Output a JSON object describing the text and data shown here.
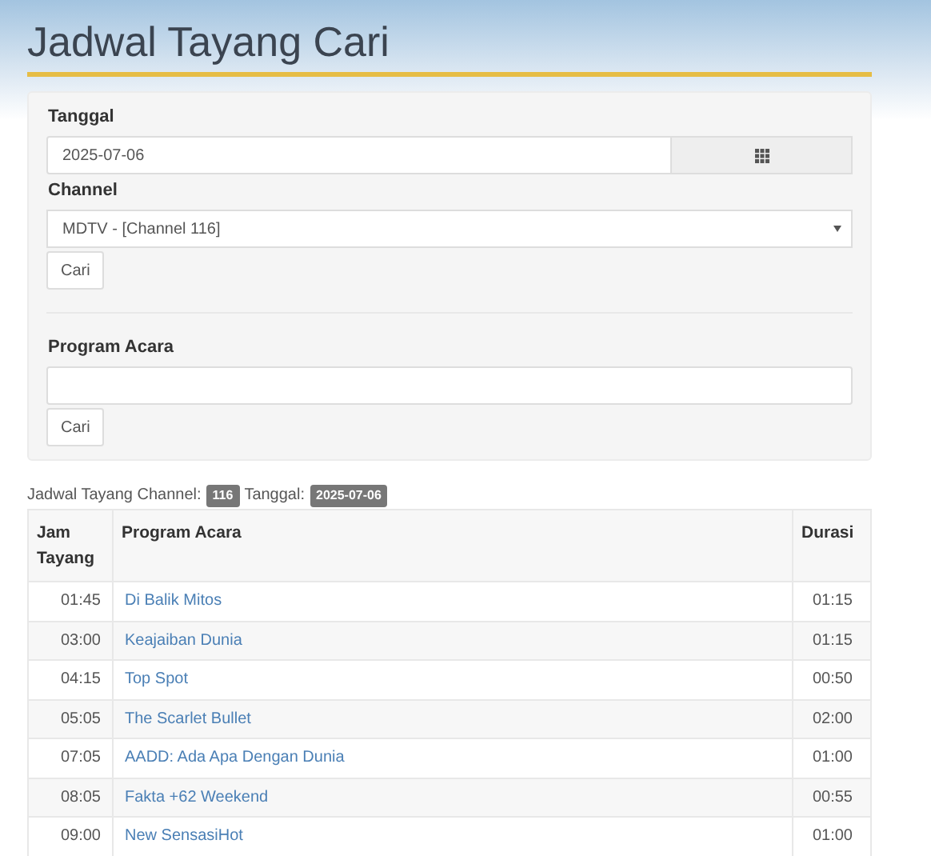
{
  "title": "Jadwal Tayang Cari",
  "form": {
    "date_label": "Tanggal",
    "date_value": "2025-07-06",
    "channel_label": "Channel",
    "channel_value": "MDTV - [Channel 116]",
    "channel_button": "Cari",
    "program_label": "Program Acara",
    "program_button": "Cari"
  },
  "caption": {
    "prefix": "Jadwal Tayang Channel:",
    "channel": "116",
    "date_label": "Tanggal:",
    "date": "2025-07-06"
  },
  "table": {
    "columns": [
      "Jam Tayang",
      "Program Acara",
      "Durasi"
    ],
    "rows": [
      {
        "time": "01:45",
        "program": "Di Balik Mitos",
        "duration": "01:15"
      },
      {
        "time": "03:00",
        "program": "Keajaiban Dunia",
        "duration": "01:15"
      },
      {
        "time": "04:15",
        "program": "Top Spot",
        "duration": "00:50"
      },
      {
        "time": "05:05",
        "program": "The Scarlet Bullet",
        "duration": "02:00"
      },
      {
        "time": "07:05",
        "program": "AADD: Ada Apa Dengan Dunia",
        "duration": "01:00"
      },
      {
        "time": "08:05",
        "program": "Fakta +62 Weekend",
        "duration": "00:55"
      },
      {
        "time": "09:00",
        "program": "New SensasiHot",
        "duration": "01:00"
      }
    ]
  }
}
